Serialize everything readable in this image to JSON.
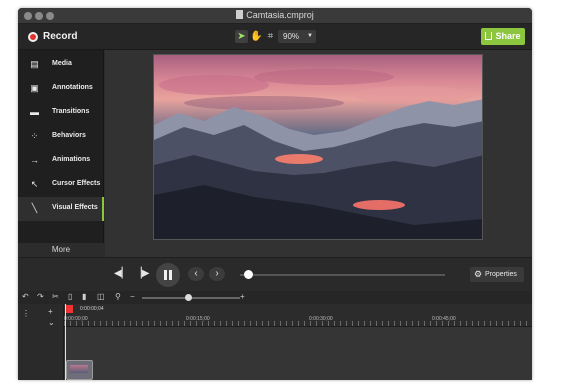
{
  "window": {
    "title": "Camtasia.cmproj"
  },
  "toolbar": {
    "record_label": "Record",
    "zoom_value": "90%",
    "share_label": "Share",
    "share_color": "#8cc63f",
    "record_color": "#e3312b"
  },
  "sidebar": {
    "items": [
      {
        "label": "Media",
        "icon": "film-icon"
      },
      {
        "label": "Annotations",
        "icon": "speech-bubble-icon"
      },
      {
        "label": "Transitions",
        "icon": "transition-icon"
      },
      {
        "label": "Behaviors",
        "icon": "behaviors-icon"
      },
      {
        "label": "Animations",
        "icon": "arrow-icon"
      },
      {
        "label": "Cursor Effects",
        "icon": "cursor-icon"
      },
      {
        "label": "Visual Effects",
        "icon": "wand-icon"
      }
    ],
    "selected": "Visual Effects",
    "more_label": "More"
  },
  "playback": {
    "properties_label": "Properties"
  },
  "timeline": {
    "current_time": "0:00:00;04",
    "ruler_labels": [
      "0:00:00;00",
      "0:00:15;00",
      "0:00:30;00",
      "0:00:45;00"
    ]
  }
}
